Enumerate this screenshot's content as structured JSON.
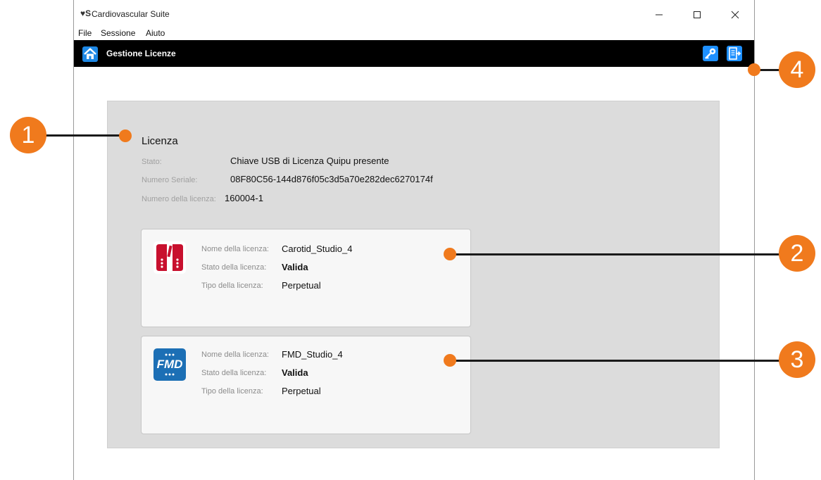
{
  "window": {
    "title": "Cardiovascular Suite",
    "logo_text": "♥S"
  },
  "menu": [
    "File",
    "Sessione",
    "Aiuto"
  ],
  "appbar": {
    "title": "Gestione Licenze"
  },
  "license": {
    "section_title": "Licenza",
    "fields": [
      {
        "label": "Stato:",
        "value": "Chiave USB di Licenza Quipu presente"
      },
      {
        "label": "Numero Seriale:",
        "value": "08F80C56-144d876f05c3d5a70e282dec6270174f"
      },
      {
        "label": "Numero della licenza:",
        "value": "160004-1"
      }
    ]
  },
  "cards": [
    {
      "icon": "carotid-studio-icon",
      "rows": [
        {
          "label": "Nome della licenza:",
          "value": "Carotid_Studio_4"
        },
        {
          "label": "Stato della licenza:",
          "value": "Valida"
        },
        {
          "label": "Tipo della licenza:",
          "value": "Perpetual"
        }
      ]
    },
    {
      "icon": "fmd-studio-icon",
      "icon_text": "FMD",
      "rows": [
        {
          "label": "Nome della licenza:",
          "value": "FMD_Studio_4"
        },
        {
          "label": "Stato della licenza:",
          "value": "Valida"
        },
        {
          "label": "Tipo della licenza:",
          "value": "Perpetual"
        }
      ]
    }
  ],
  "callouts": [
    "1",
    "2",
    "3",
    "4"
  ],
  "colors": {
    "callout": "#f07a1d",
    "appbar": "#000000",
    "panel": "#dcdcdc",
    "carotid_icon": "#c8102e",
    "fmd_icon": "#1c6fb5",
    "appbar_icon": "#1e90ff"
  }
}
